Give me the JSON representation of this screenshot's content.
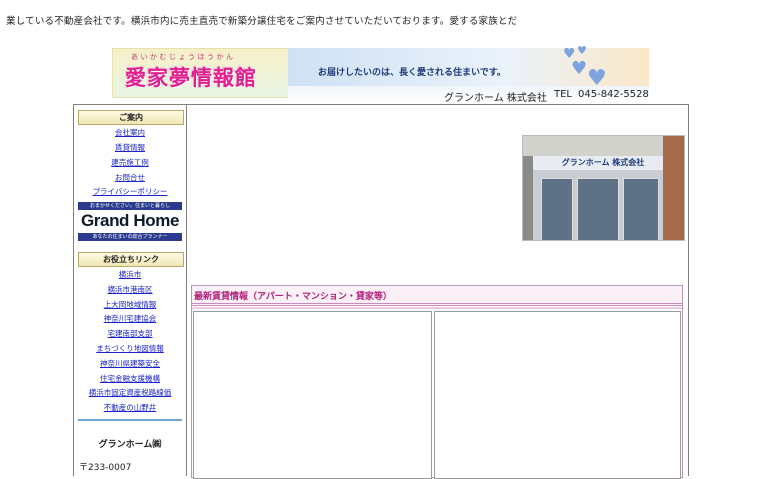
{
  "marquee_text": "業している不動産会社です。横浜市内に売主直売で新築分譲住宅をご案内させていただいております。愛する家族とだ",
  "banner": {
    "logo_furigana": "あいかむじょうほうかん",
    "logo_title": "愛家夢情報館",
    "tagline": "お届けしたいのは、長く愛される住まいです。",
    "company": "グランホーム 株式会社",
    "tel_label": "TEL",
    "tel_number": "045-842-5528"
  },
  "sidebar": {
    "guide_heading": "ご案内",
    "guide_links": [
      "会社案内",
      "賃貸情報",
      "建売施工例",
      "お問合せ",
      "プライバシーポリシー"
    ],
    "logo_top": "おまかせください。住まいと暮らし",
    "logo_name": "Grand Home",
    "logo_sub": "あなたの住まいの総合プランナー",
    "useful_heading": "お役立ちリンク",
    "useful_links": [
      "横浜市",
      "横浜市港南区",
      "上大岡地域情報",
      "神奈川宅建協会",
      "宅建南部支部",
      "まちづくり地図情報",
      "神奈川県建築安全",
      "住宅金融支援機構",
      "横浜市固定資産税路線価",
      "不動産の山野井"
    ],
    "company_name": "グランホーム㈱",
    "postal": "〒233-0007"
  },
  "main": {
    "photo_sign": "グランホーム 株式会社",
    "rental_title": "最新賃貸情報（アパート・マンション・貸家等）"
  },
  "colors": {
    "logo_pink": "#e0208e",
    "link_blue": "#1a24c8",
    "rental_title": "#b4207d",
    "navy": "#2a3b8f"
  }
}
